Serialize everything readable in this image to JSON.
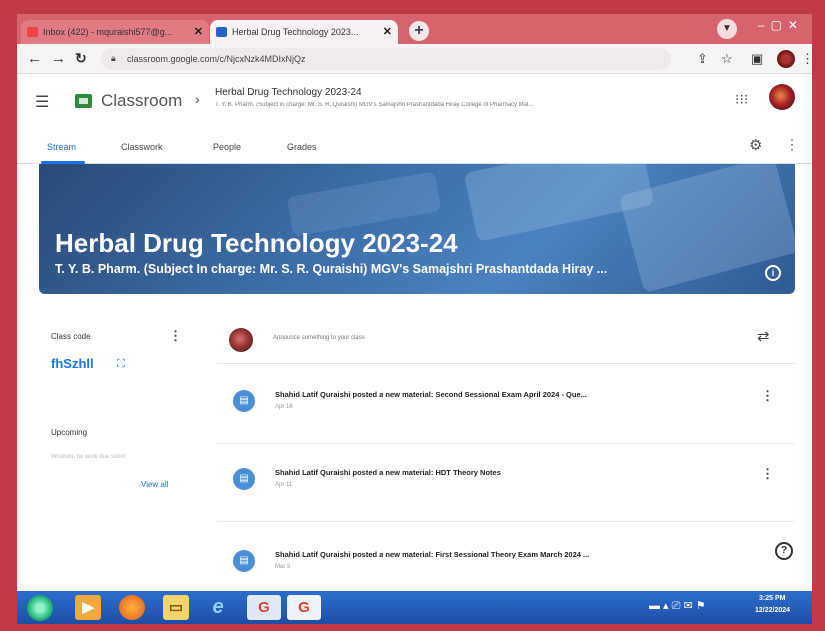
{
  "browser": {
    "tabs": [
      {
        "label": "Inbox (422) - mquraishi577@g..."
      },
      {
        "label": "Herbal Drug Technology 2023..."
      }
    ],
    "url": "classroom.google.com/c/NjcxNzk4MDIxNjQz"
  },
  "header": {
    "app_name": "Classroom",
    "course_name": "Herbal Drug Technology 2023-24",
    "course_subtitle": "T. Y. B. Pharm. (Subject in charge: Mr. S. R. Quraishi) MGV's Samajshri Prashantdada Hiray College of Pharmacy Mal..."
  },
  "nav": {
    "tabs": [
      "Stream",
      "Classwork",
      "People",
      "Grades"
    ]
  },
  "banner": {
    "title": "Herbal Drug Technology 2023-24",
    "subtitle": "T. Y. B. Pharm. (Subject In charge: Mr. S. R. Quraishi) MGV's Samajshri Prashantdada Hiray ..."
  },
  "class_code": {
    "label": "Class code",
    "value": "fhSzhll"
  },
  "upcoming": {
    "label": "Upcoming",
    "sub": "Woohoo, no work due soon!",
    "view_all": "View all"
  },
  "stream": {
    "announce_placeholder": "Announce something to your class",
    "posts": [
      {
        "text": "Shahid Latif Quraishi posted a new material: Second Sessional Exam April 2024 - Que...",
        "date": "Apr 16"
      },
      {
        "text": "Shahid Latif Quraishi posted a new material: HDT Theory Notes",
        "date": "Apr 11"
      },
      {
        "text": "Shahid Latif Quraishi posted a new material: First Sessional Theory Exam March 2024 ...",
        "date": "Mar 5"
      }
    ]
  },
  "taskbar": {
    "time": "3:25 PM",
    "date": "12/22/2024"
  },
  "colors": {
    "accent": "#1a73e8",
    "banner": "#3c6ea8",
    "taskbar": "#2c6fcf"
  }
}
